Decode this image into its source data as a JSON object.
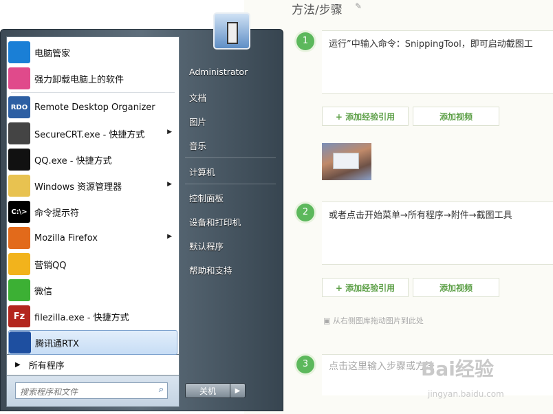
{
  "article": {
    "title": "方法/步骤",
    "steps": [
      {
        "num": "1",
        "text": "运行”中输入命令：SnippingTool，即可启动截图工"
      },
      {
        "num": "2",
        "text": "或者点击开始菜单→所有程序→附件→截图工具"
      },
      {
        "num": "3",
        "placeholder": "点击这里输入步骤或方法"
      }
    ],
    "add_ref_label": "+ 添加经验引用",
    "add_video_label": "添加视频",
    "drag_hint": "从右侧图库拖动图片到此处",
    "watermark": "Bai经验",
    "watermark_url": "jingyan.baidu.com"
  },
  "start_menu": {
    "programs": [
      {
        "label": "电脑管家",
        "icon": "shield-icon",
        "color": "#1a7fd6"
      },
      {
        "label": "强力卸载电脑上的软件",
        "icon": "flower-icon",
        "color": "#e04a8b"
      },
      {
        "label": "Remote Desktop Organizer",
        "icon": "rdo-icon",
        "color": "#2d5fa3",
        "glyph": "RDO"
      },
      {
        "label": "SecureCRT.exe - 快捷方式",
        "icon": "securecrt-icon",
        "color": "#444",
        "arrow": true
      },
      {
        "label": "QQ.exe - 快捷方式",
        "icon": "qq-penguin-icon",
        "color": "#111"
      },
      {
        "label": "Windows 资源管理器",
        "icon": "folder-icon",
        "color": "#e8c250",
        "arrow": true
      },
      {
        "label": "命令提示符",
        "icon": "cmd-icon",
        "color": "#000",
        "glyph": "C:\\>"
      },
      {
        "label": "Mozilla Firefox",
        "icon": "firefox-icon",
        "color": "#e26a1b",
        "arrow": true
      },
      {
        "label": "营销QQ",
        "icon": "yingxiao-qq-icon",
        "color": "#f2b31c"
      },
      {
        "label": "微信",
        "icon": "wechat-icon",
        "color": "#3cb034"
      },
      {
        "label": "filezilla.exe - 快捷方式",
        "icon": "filezilla-icon",
        "color": "#b3261e",
        "glyph": "Fz"
      },
      {
        "label": "腾讯通RTX",
        "icon": "rtx-icon",
        "color": "#1e4fa0",
        "selected": true
      }
    ],
    "all_programs_label": "所有程序",
    "search_placeholder": "搜索程序和文件",
    "right_items": [
      "Administrator",
      "文档",
      "图片",
      "音乐",
      "计算机",
      "控制面板",
      "设备和打印机",
      "默认程序",
      "帮助和支持"
    ],
    "shutdown_label": "关机"
  }
}
